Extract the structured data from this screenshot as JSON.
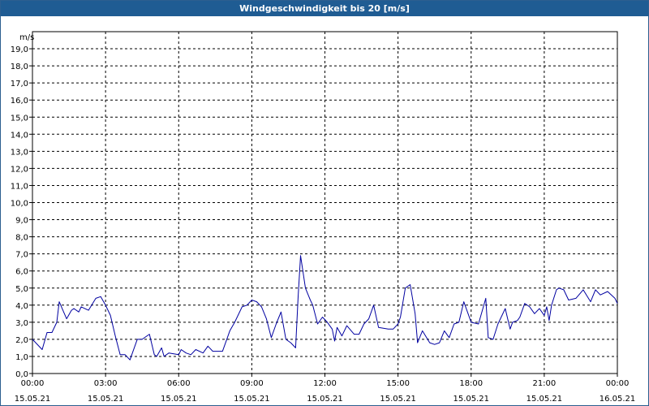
{
  "window": {
    "title": "Windgeschwindigkeit bis 20 [m/s]"
  },
  "chart_data": {
    "type": "line",
    "title": "Windgeschwindigkeit bis 20 [m/s]",
    "ylabel": "m/s",
    "xlabel": "",
    "ylim": [
      0,
      20
    ],
    "xlim_hours": [
      0,
      24
    ],
    "grid": true,
    "y_ticks": [
      "0,0",
      "1,0",
      "2,0",
      "3,0",
      "4,0",
      "5,0",
      "6,0",
      "7,0",
      "8,0",
      "9,0",
      "10,0",
      "11,0",
      "12,0",
      "13,0",
      "14,0",
      "15,0",
      "16,0",
      "17,0",
      "18,0",
      "19,0"
    ],
    "x_ticks": [
      {
        "time": "00:00",
        "date": "15.05.21"
      },
      {
        "time": "03:00",
        "date": "15.05.21"
      },
      {
        "time": "06:00",
        "date": "15.05.21"
      },
      {
        "time": "09:00",
        "date": "15.05.21"
      },
      {
        "time": "12:00",
        "date": "15.05.21"
      },
      {
        "time": "15:00",
        "date": "15.05.21"
      },
      {
        "time": "18:00",
        "date": "15.05.21"
      },
      {
        "time": "21:00",
        "date": "15.05.21"
      },
      {
        "time": "00:00",
        "date": "16.05.21"
      }
    ],
    "series": [
      {
        "color": "#0000a0",
        "x": [
          0.0,
          0.4,
          0.6,
          0.8,
          1.0,
          1.1,
          1.4,
          1.6,
          1.7,
          1.9,
          2.0,
          2.3,
          2.6,
          2.8,
          3.0,
          3.2,
          3.4,
          3.6,
          3.8,
          4.0,
          4.3,
          4.5,
          4.8,
          5.0,
          5.1,
          5.3,
          5.4,
          5.6,
          6.0,
          6.1,
          6.3,
          6.5,
          6.7,
          7.0,
          7.2,
          7.4,
          7.6,
          7.8,
          8.1,
          8.3,
          8.6,
          8.8,
          9.0,
          9.2,
          9.4,
          9.6,
          9.8,
          10.0,
          10.2,
          10.4,
          10.6,
          10.8,
          10.9,
          11.0,
          11.2,
          11.4,
          11.5,
          11.7,
          11.9,
          12.1,
          12.3,
          12.4,
          12.5,
          12.7,
          12.9,
          13.2,
          13.4,
          13.6,
          13.8,
          14.0,
          14.2,
          14.6,
          14.8,
          15.0,
          15.1,
          15.3,
          15.5,
          15.7,
          15.8,
          16.0,
          16.3,
          16.5,
          16.7,
          16.9,
          17.1,
          17.3,
          17.5,
          17.7,
          18.0,
          18.3,
          18.6,
          18.7,
          18.9,
          19.1,
          19.4,
          19.6,
          19.7,
          19.9,
          20.0,
          20.2,
          20.4,
          20.6,
          20.8,
          21.0,
          21.1,
          21.2,
          21.3,
          21.5,
          21.6,
          21.8,
          22.0,
          22.3,
          22.6,
          22.9,
          23.1,
          23.3,
          23.6,
          23.9,
          24.0
        ],
        "values": [
          2.0,
          1.4,
          2.4,
          2.4,
          3.0,
          4.2,
          3.2,
          3.7,
          3.8,
          3.6,
          3.9,
          3.7,
          4.4,
          4.5,
          4.0,
          3.4,
          2.2,
          1.1,
          1.1,
          0.8,
          2.0,
          2.0,
          2.3,
          1.1,
          1.0,
          1.5,
          1.0,
          1.2,
          1.1,
          1.4,
          1.2,
          1.1,
          1.4,
          1.2,
          1.6,
          1.3,
          1.3,
          1.3,
          2.5,
          3.0,
          3.9,
          4.0,
          4.3,
          4.2,
          3.9,
          3.2,
          2.1,
          2.9,
          3.6,
          2.0,
          1.8,
          1.5,
          4.5,
          6.9,
          5.0,
          4.3,
          4.0,
          2.9,
          3.3,
          3.0,
          2.6,
          1.9,
          2.7,
          2.2,
          2.8,
          2.3,
          2.3,
          2.9,
          3.2,
          4.0,
          2.7,
          2.6,
          2.6,
          2.9,
          3.3,
          5.0,
          5.2,
          3.5,
          1.8,
          2.5,
          1.8,
          1.7,
          1.8,
          2.5,
          2.1,
          2.9,
          3.0,
          4.2,
          3.0,
          2.9,
          4.4,
          2.1,
          2.0,
          2.9,
          3.8,
          2.6,
          3.0,
          3.1,
          3.3,
          4.1,
          3.9,
          3.5,
          3.8,
          3.4,
          3.9,
          3.1,
          4.0,
          4.9,
          5.0,
          4.9,
          4.3,
          4.4,
          4.9,
          4.2,
          4.9,
          4.6,
          4.8,
          4.4,
          4.1
        ]
      }
    ]
  }
}
